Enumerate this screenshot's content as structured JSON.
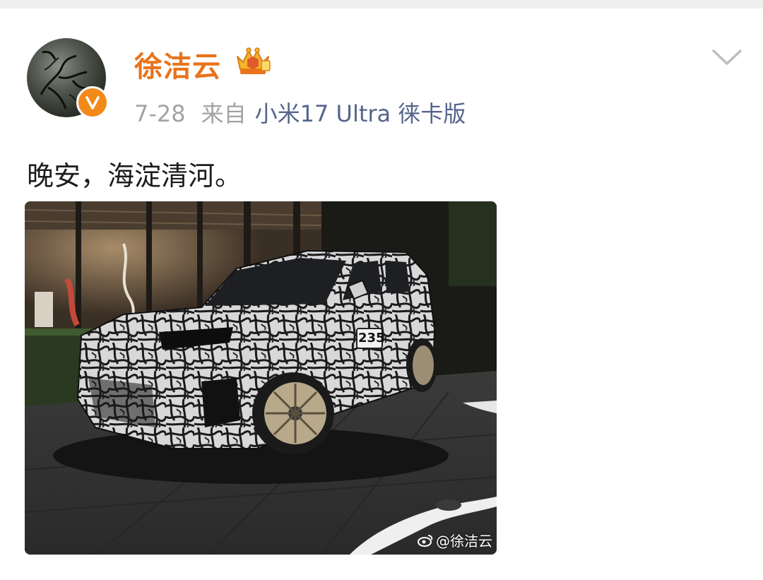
{
  "post": {
    "username": "徐洁云",
    "date": "7-28",
    "from_label": "来自",
    "source_device": "小米17 Ultra 徕卡版",
    "text": "晚安，海淀清河。",
    "photo": {
      "plate_number": "235",
      "watermark": "@徐洁云"
    }
  },
  "icons": {
    "verified": "verified-v-badge",
    "member": "crown-member-badge",
    "expand": "chevron-down-icon",
    "watermark": "weibo-logo-icon"
  },
  "colors": {
    "username": "#e8731b",
    "meta": "#a3a3a3",
    "source_link": "#54658c",
    "verified_badge": "#f28a1a",
    "text": "#1c1c1c"
  }
}
